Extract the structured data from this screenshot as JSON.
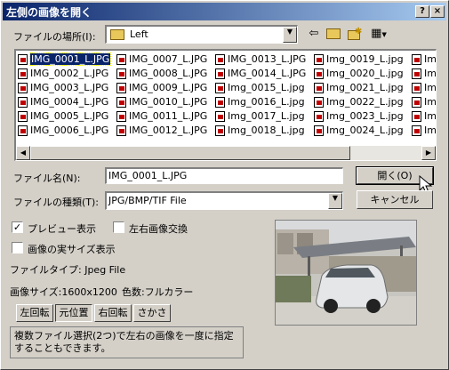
{
  "window": {
    "title": "左側の画像を開く",
    "help_glyph": "?",
    "close_glyph": "×"
  },
  "lookin": {
    "label": "ファイルの場所(I):",
    "value": "Left",
    "folder_icon": "folder-icon"
  },
  "toolbar": {
    "back_glyph": "⇦",
    "up_glyph": "⇧",
    "newfolder_glyph": "✱",
    "view_glyph": "▦"
  },
  "files": [
    [
      "IMG_0001_L.JPG",
      "IMG_0002_L.JPG",
      "IMG_0003_L.JPG",
      "IMG_0004_L.JPG",
      "IMG_0005_L.JPG",
      "IMG_0006_L.JPG"
    ],
    [
      "IMG_0007_L.JPG",
      "IMG_0008_L.JPG",
      "IMG_0009_L.JPG",
      "IMG_0010_L.JPG",
      "IMG_0011_L.JPG",
      "IMG_0012_L.JPG"
    ],
    [
      "IMG_0013_L.JPG",
      "IMG_0014_L.JPG",
      "Img_0015_L.jpg",
      "Img_0016_L.jpg",
      "Img_0017_L.jpg",
      "Img_0018_L.jpg"
    ],
    [
      "Img_0019_L.jpg",
      "Img_0020_L.jpg",
      "Img_0021_L.jpg",
      "Img_0022_L.jpg",
      "Img_0023_L.jpg",
      "Img_0024_L.jpg"
    ],
    [
      "Im",
      "Im",
      "Im",
      "Im",
      "Im",
      "Im"
    ]
  ],
  "selected_file": "IMG_0001_L.JPG",
  "filename": {
    "label": "ファイル名(N):",
    "value": "IMG_0001_L.JPG"
  },
  "filetype": {
    "label": "ファイルの種類(T):",
    "value": "JPG/BMP/TIF File"
  },
  "buttons": {
    "open": "開く(O)",
    "cancel": "キャンセル"
  },
  "options": {
    "preview": {
      "label": "プレビュー表示",
      "checked": true
    },
    "swap": {
      "label": "左右画像交換",
      "checked": false
    },
    "actual_size": {
      "label": "画像の実サイズ表示",
      "checked": false
    }
  },
  "info": {
    "file_type": "ファイルタイプ: Jpeg File",
    "image_size": "画像サイズ:1600x1200",
    "colors": "色数:フルカラー"
  },
  "rotate_buttons": [
    "左回転",
    "元位置",
    "右回転",
    "さかさ"
  ],
  "hint": "複数ファイル選択(2つ)で左右の画像を一度に指定することもできます。",
  "check_glyph": "✓",
  "colors": {
    "title_start": "#0a246a",
    "title_end": "#a6caf0",
    "selection": "#0a246a",
    "face": "#d4d0c8"
  }
}
